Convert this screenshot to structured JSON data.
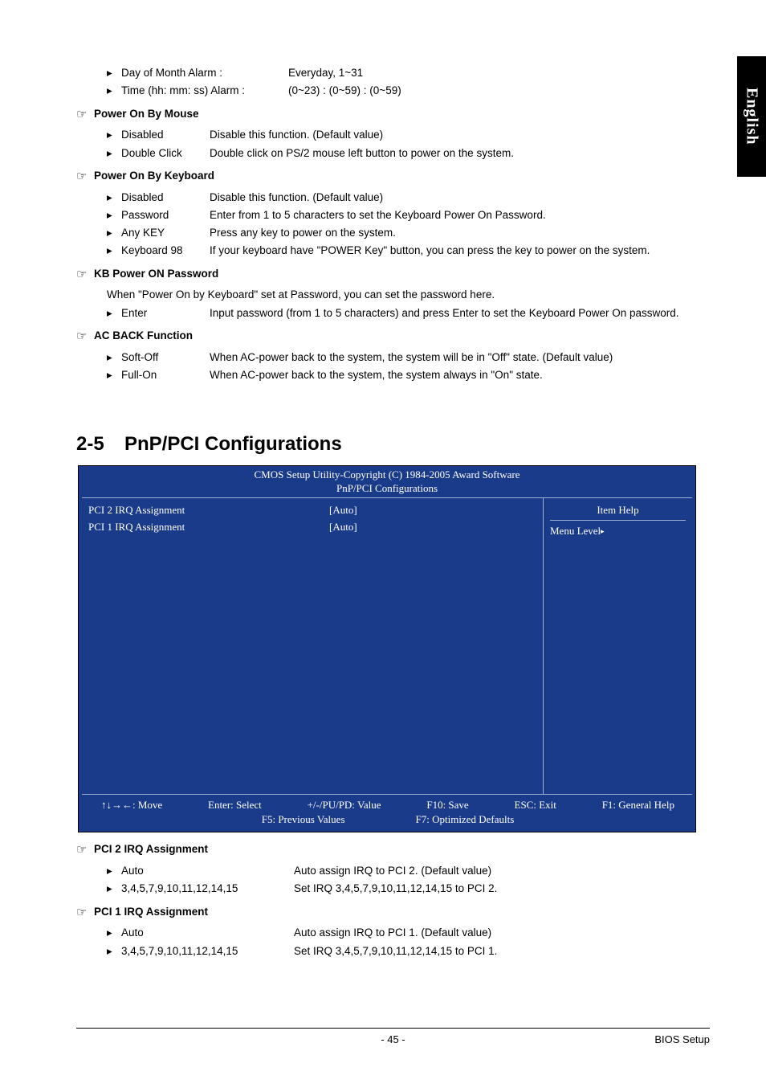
{
  "sideTab": "English",
  "top": {
    "dayOfMonth": {
      "label": "Day of Month Alarm :",
      "value": "Everyday, 1~31"
    },
    "timeAlarm": {
      "label": "Time (hh: mm: ss) Alarm :",
      "value": "(0~23) : (0~59) : (0~59)"
    }
  },
  "powerOnByMouse": {
    "heading": "Power On By Mouse",
    "rows": [
      {
        "label": "Disabled",
        "desc": "Disable this function. (Default value)"
      },
      {
        "label": "Double Click",
        "desc": "Double click on PS/2 mouse left button to power on the system."
      }
    ]
  },
  "powerOnByKeyboard": {
    "heading": "Power On By Keyboard",
    "rows": [
      {
        "label": "Disabled",
        "desc": "Disable this function. (Default value)"
      },
      {
        "label": "Password",
        "desc": "Enter from 1 to 5 characters to set the Keyboard Power On Password."
      },
      {
        "label": "Any KEY",
        "desc": "Press any key to power on the system."
      },
      {
        "label": "Keyboard 98",
        "desc": "If your keyboard have \"POWER Key\" button, you can press the key to power on the system."
      }
    ]
  },
  "kbPowerOn": {
    "heading": "KB Power ON Password",
    "intro": "When \"Power On by Keyboard\" set at Password, you can set the password here.",
    "rows": [
      {
        "label": "Enter",
        "desc": "Input password (from 1 to 5 characters) and press Enter to set the Keyboard Power On password."
      }
    ]
  },
  "acBack": {
    "heading": "AC BACK Function",
    "rows": [
      {
        "label": "Soft-Off",
        "desc": "When AC-power back to the system, the system will be in \"Off\" state. (Default value)"
      },
      {
        "label": "Full-On",
        "desc": "When AC-power back to the system, the system always in \"On\" state."
      }
    ]
  },
  "section": {
    "num": "2-5",
    "title": "PnP/PCI Configurations"
  },
  "bios": {
    "title1": "CMOS Setup Utility-Copyright (C) 1984-2005 Award Software",
    "title2": "PnP/PCI Configurations",
    "rows": [
      {
        "label": "PCI 2 IRQ Assignment",
        "value": "[Auto]"
      },
      {
        "label": "PCI 1 IRQ Assignment",
        "value": "[Auto]"
      }
    ],
    "helpHeader": "Item Help",
    "menuLevel": "Menu Level",
    "foot": {
      "move": "↑↓→←: Move",
      "enter": "Enter: Select",
      "pupd": "+/-/PU/PD: Value",
      "f10": "F10: Save",
      "esc": "ESC: Exit",
      "f1": "F1: General Help",
      "f5": "F5: Previous Values",
      "f7": "F7: Optimized Defaults"
    }
  },
  "pci2": {
    "heading": "PCI 2 IRQ Assignment",
    "rows": [
      {
        "label": "Auto",
        "desc": "Auto assign IRQ to PCI 2. (Default value)"
      },
      {
        "label": "3,4,5,7,9,10,11,12,14,15",
        "desc": "Set IRQ 3,4,5,7,9,10,11,12,14,15 to PCI 2."
      }
    ]
  },
  "pci1": {
    "heading": "PCI 1 IRQ Assignment",
    "rows": [
      {
        "label": "Auto",
        "desc": "Auto assign IRQ to PCI 1. (Default value)"
      },
      {
        "label": "3,4,5,7,9,10,11,12,14,15",
        "desc": "Set IRQ 3,4,5,7,9,10,11,12,14,15 to PCI 1."
      }
    ]
  },
  "footer": {
    "page": "- 45 -",
    "right": "BIOS Setup"
  }
}
